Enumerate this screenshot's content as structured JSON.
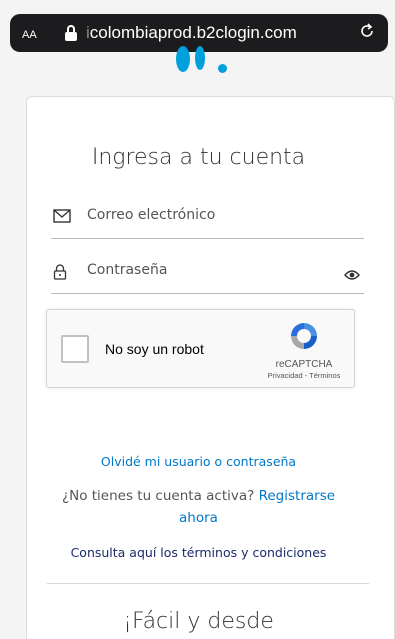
{
  "browser": {
    "text_size_label": "AA",
    "url_faded": "i",
    "url": "colombiaprod.b2clogin.com",
    "reload_icon": "reload-icon"
  },
  "login": {
    "title": "Ingresa a tu cuenta",
    "email_label": "Correo electrónico",
    "password_label": "Contraseña"
  },
  "recaptcha": {
    "label": "No soy un robot",
    "brand": "reCAPTCHA",
    "terms": "Privacidad - Términos"
  },
  "links": {
    "forgot": "Olvidé mi usuario o contraseña",
    "inactive_prompt": "¿No tienes tu cuenta activa?",
    "register": "Registrarse ahora",
    "terms": "Consulta aquí los términos y condiciones"
  },
  "footer": {
    "heading": "¡Fácil y desde"
  },
  "colors": {
    "link": "#0078c8",
    "terms_link": "#1a2b6a",
    "brand_blue": "#00a0dc"
  }
}
